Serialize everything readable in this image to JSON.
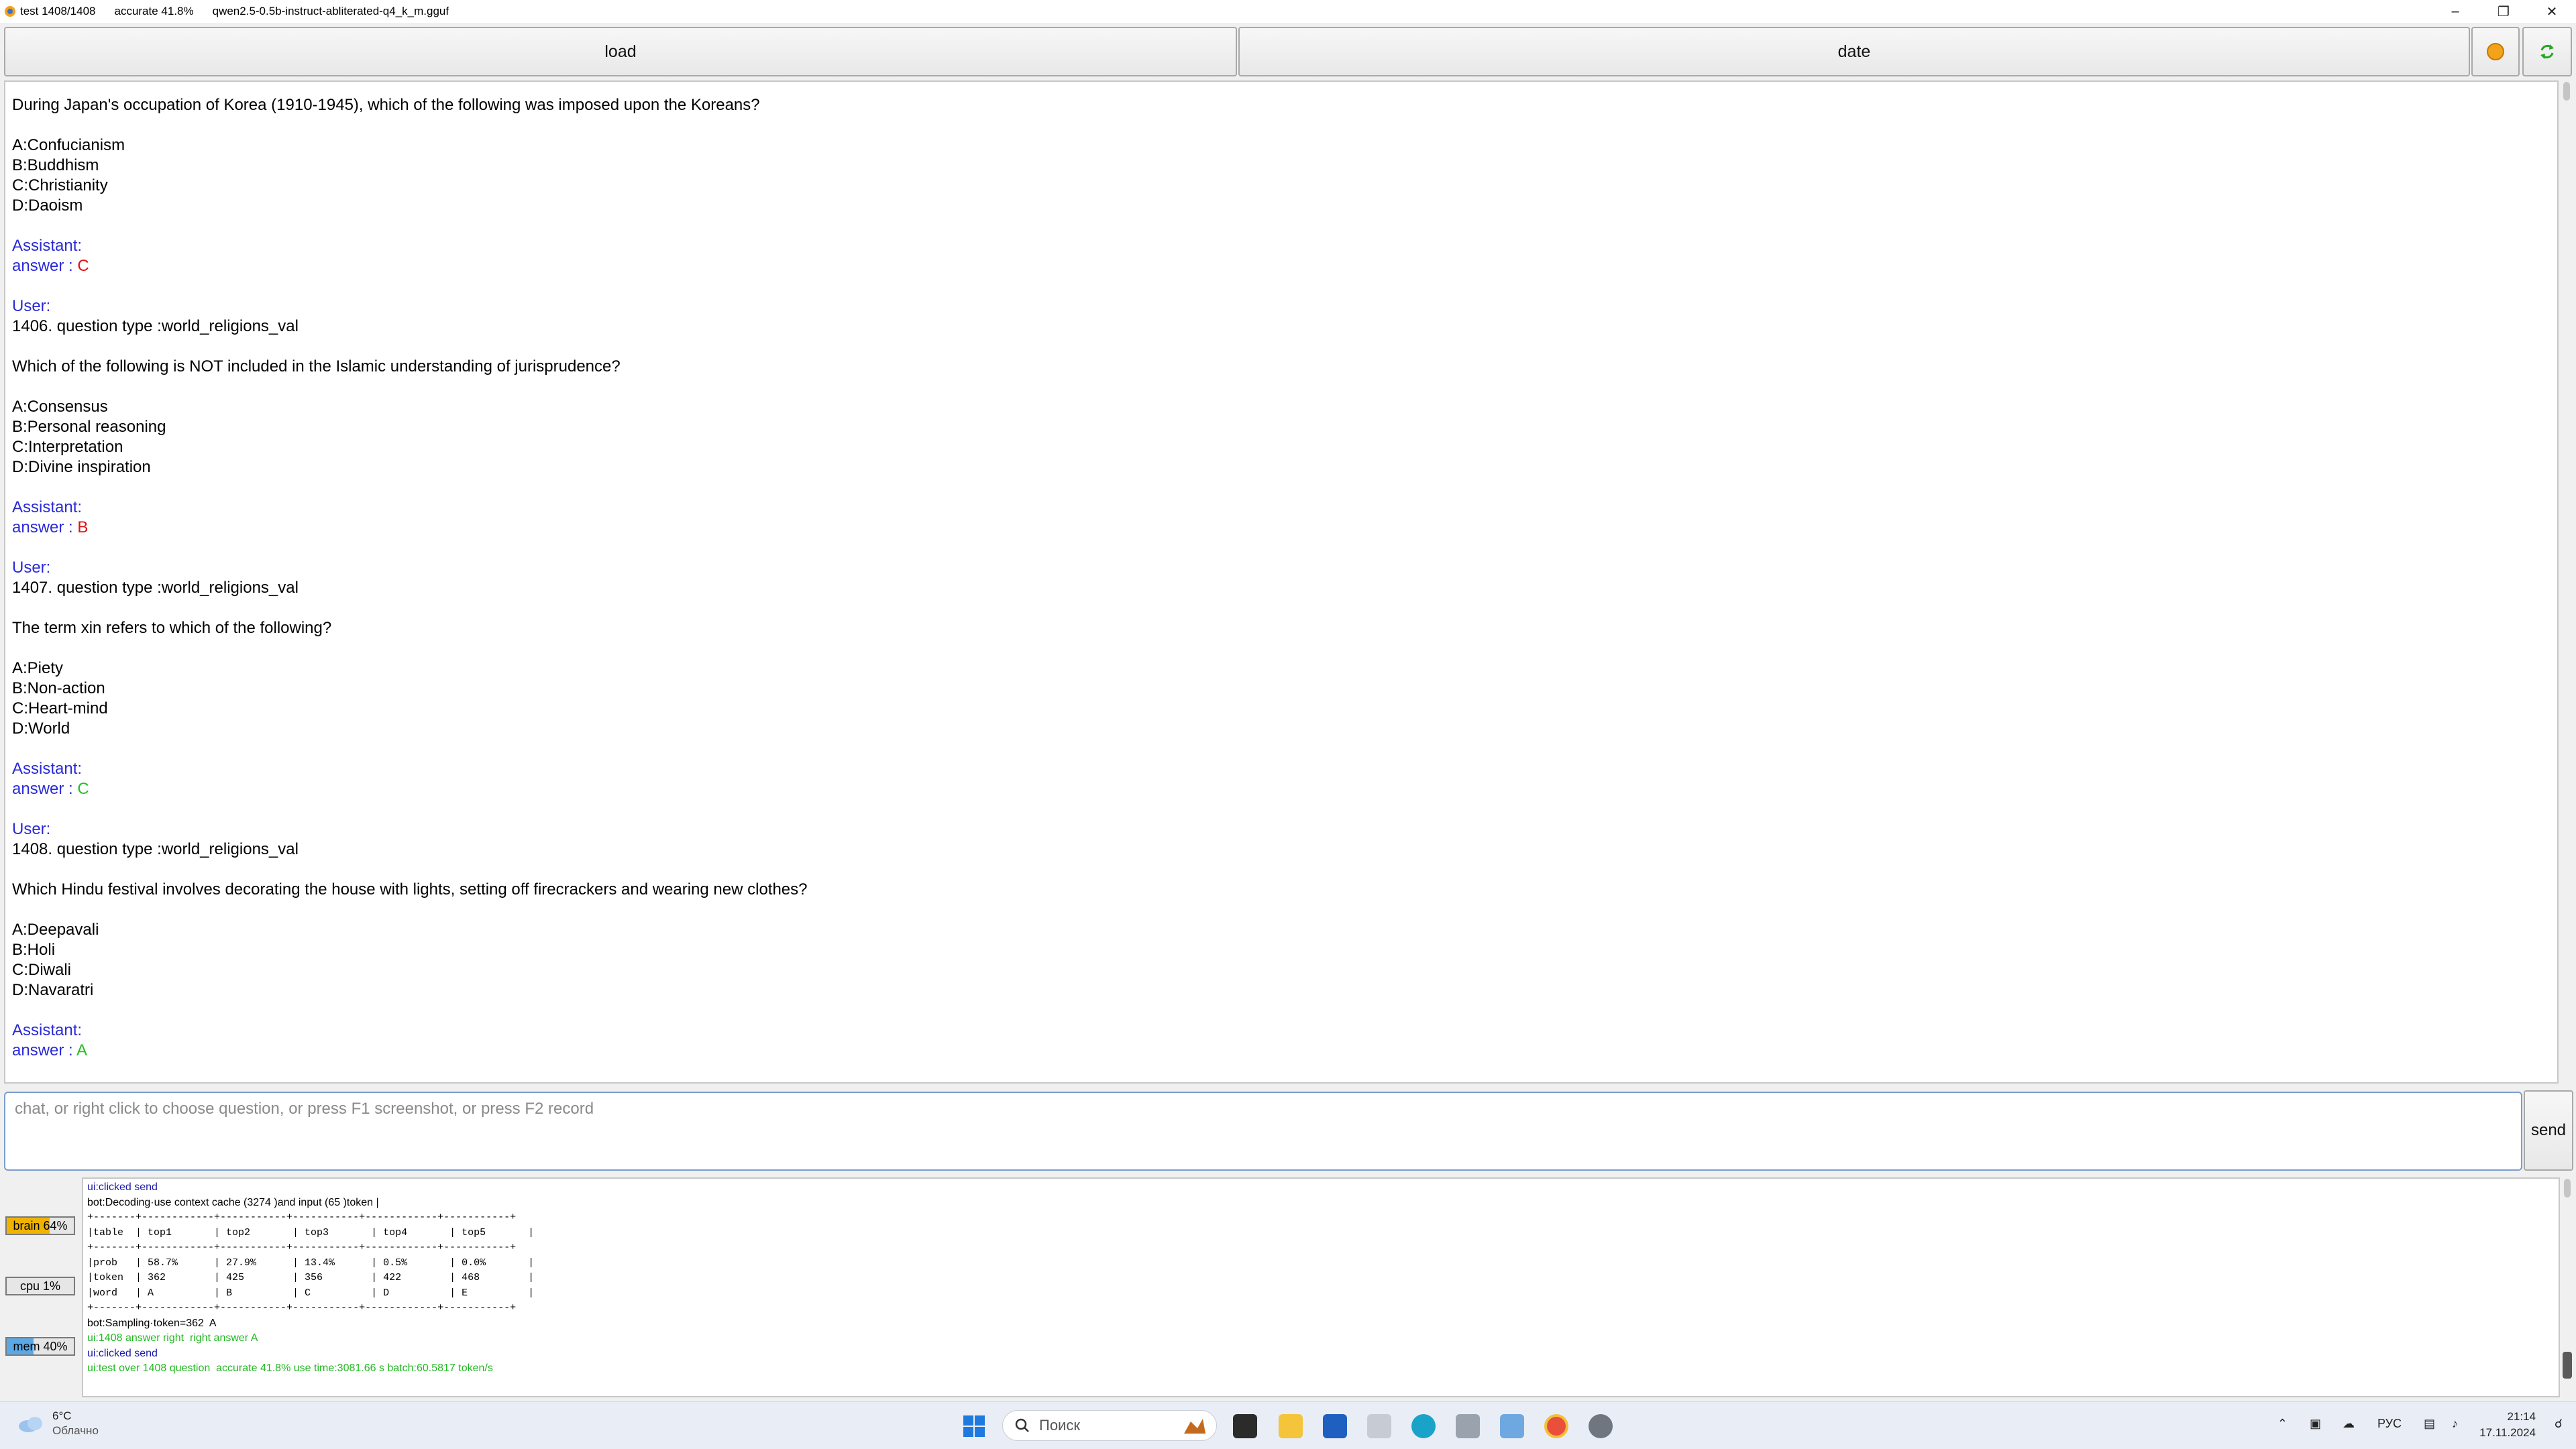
{
  "titlebar": {
    "status": "test 1408/1408",
    "accuracy": "accurate 41.8%",
    "model": "qwen2.5-0.5b-instruct-abliterated-q4_k_m.gguf"
  },
  "toolbar": {
    "load_label": "load",
    "date_label": "date"
  },
  "chat": {
    "q_intro": "During Japan's occupation of Korea (1910-1945), which of the following was imposed upon the Koreans?",
    "q1": {
      "a": "A:Confucianism",
      "b": "B:Buddhism",
      "c": "C:Christianity",
      "d": "D:Daoism",
      "answer_prefix": "answer : ",
      "answer": "C"
    },
    "q2": {
      "header": "1406. question type :world_religions_val",
      "question": "Which of the following is NOT included in the Islamic understanding of jurisprudence?",
      "a": "A:Consensus",
      "b": "B:Personal reasoning",
      "c": "C:Interpretation",
      "d": "D:Divine inspiration",
      "answer_prefix": "answer : ",
      "answer": "B"
    },
    "q3": {
      "header": "1407. question type :world_religions_val",
      "question": "The term xin refers to which of the following?",
      "a": "A:Piety",
      "b": "B:Non-action",
      "c": "C:Heart-mind",
      "d": "D:World",
      "answer_prefix": "answer : ",
      "answer": "C"
    },
    "q4": {
      "header": "1408. question type :world_religions_val",
      "question": "Which Hindu festival involves decorating the house with lights, setting off firecrackers and wearing new clothes?",
      "a": "A:Deepavali",
      "b": "B:Holi",
      "c": "C:Diwali",
      "d": "D:Navaratri",
      "answer_prefix": "answer : ",
      "answer": "A"
    },
    "assistant_label": "Assistant:",
    "user_label": "User:"
  },
  "input": {
    "placeholder": "chat, or right click to choose question, or press F1 screenshot, or press F2 record",
    "value": "",
    "send_label": "send"
  },
  "monitor": {
    "brain": {
      "label": "brain 64%",
      "level": 0.64,
      "color": "#f0b400"
    },
    "cpu": {
      "label": "cpu 1%",
      "level": 0.01,
      "color": "#e0e0e0"
    },
    "mem": {
      "label": "mem 40%",
      "level": 0.4,
      "color": "#5aa9e6"
    }
  },
  "log": {
    "l1": "ui:clicked send",
    "l2": "bot:Decoding·use context cache (3274 )and input (65 )token |",
    "sep": "+-------+------------+-----------+-----------+------------+-----------+",
    "row_head": "|table  | top1       | top2       | top3       | top4       | top5       |",
    "row_prob": "|prob   | 58.7%      | 27.9%      | 13.4%      | 0.5%       | 0.0%       |",
    "row_token": "|token  | 362        | 425        | 356        | 422        | 468        |",
    "row_word": "|word   | A          | B          | C          | D          | E          |",
    "l_sampling": "bot:Sampling·token=362  A",
    "l_right": "ui:1408 answer right  right answer A",
    "l_clicked2": "ui:clicked send",
    "l_over": "ui:test over 1408 question  accurate 41.8% use time:3081.66 s batch:60.5817 token/s"
  },
  "taskbar": {
    "temp": "6°C",
    "weather": "Облачно",
    "search_placeholder": "Поиск",
    "lang": "РУС",
    "time": "21:14",
    "date": "17.11.2024"
  },
  "icons": {
    "app": "app-logo-icon",
    "orange": "status-dot-icon",
    "refresh": "refresh-icon"
  }
}
